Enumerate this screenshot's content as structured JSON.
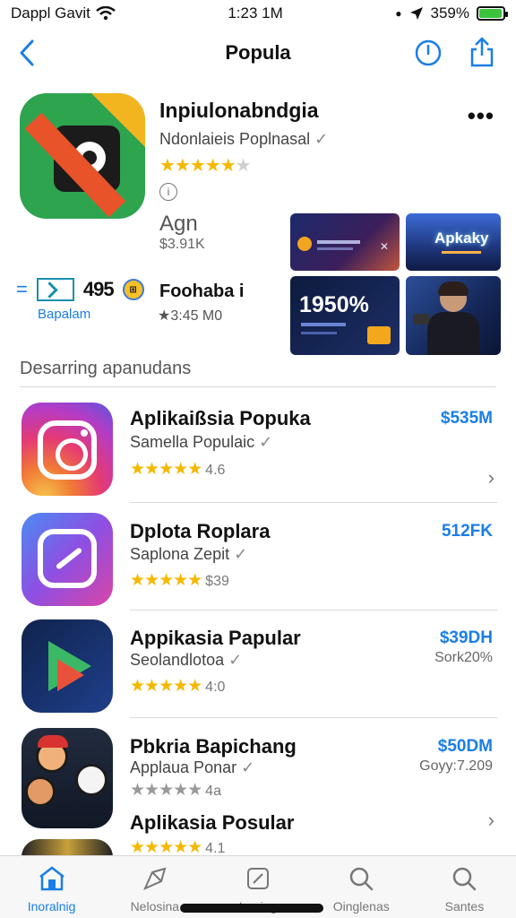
{
  "status": {
    "carrier": "Dappl Gavit",
    "time": "1:23 1M",
    "battery": "359%",
    "battery_fill": 0.95
  },
  "nav": {
    "title": "Popula"
  },
  "featured": {
    "title": "Inpiulonabndgia",
    "subtitle": "Ndonlaieis Poplnasal",
    "stars": "★★★★★",
    "empty_stars": "★",
    "action": "Agn",
    "price": "$3.91K",
    "info_symbol": "i"
  },
  "second": {
    "badge_number": "495",
    "badge_caption": "Bapalam",
    "title": "Foohaba i",
    "meta": "★3:45 M0"
  },
  "shots": {
    "shot2_text": "Apkaky",
    "shot3_text": "1950%"
  },
  "section": {
    "title": "Desarring apanudans"
  },
  "rows": [
    {
      "title": "Aplikaißsia Popuka",
      "subtitle": "Samella Populaic",
      "stars": "★★★★★",
      "rating": "4.6",
      "price": "$535M",
      "meta": ""
    },
    {
      "title": "Dplota Roplara",
      "subtitle": "Saplona Zepit",
      "stars": "★★★★★",
      "rating": "$39",
      "price": "512FK",
      "meta": ""
    },
    {
      "title": "Appikasia Papular",
      "subtitle": "Seolandlotoa",
      "stars": "★★★★★",
      "rating": "4:0",
      "price": "$39DH",
      "meta": "Sork20%"
    },
    {
      "title": "Pbkria Bapichang",
      "subtitle": "Applaua Ponar",
      "stars": "★★★★★",
      "rating": "4a",
      "price": "$50DM",
      "meta": "Goyy:7.209"
    },
    {
      "title": "Aplikasia Posular",
      "subtitle": "",
      "stars": "★★★★★",
      "rating": "4.1",
      "price": "",
      "meta": ""
    }
  ],
  "tabs": [
    {
      "label": "Inoralnig"
    },
    {
      "label": "Nelosina"
    },
    {
      "label": "Irnaing"
    },
    {
      "label": "Oinglenas"
    },
    {
      "label": "Santes"
    }
  ],
  "colors": {
    "accent": "#1a7ee6",
    "star": "#f5b800"
  }
}
